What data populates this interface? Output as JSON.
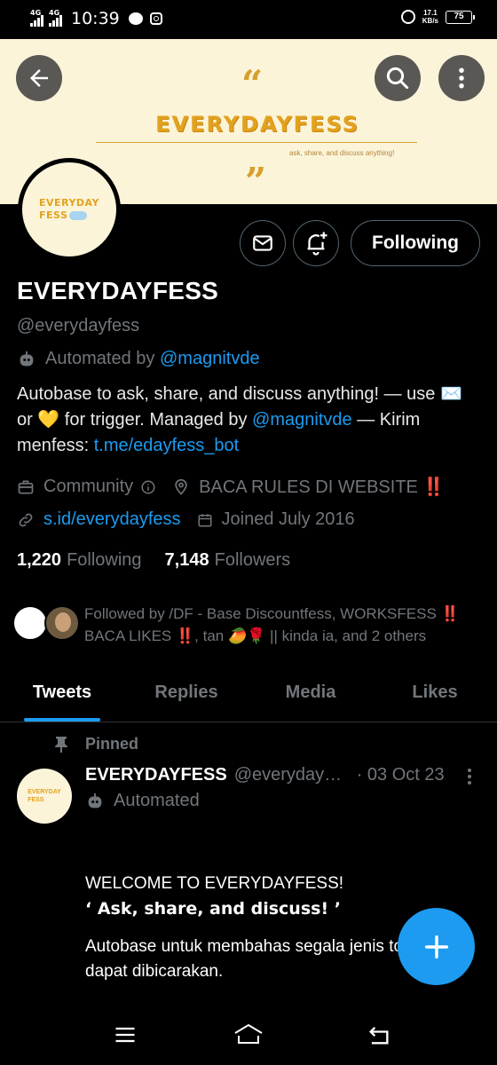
{
  "status_bar": {
    "network1": "4G",
    "network2": "4G",
    "time": "10:39",
    "speed_value": "17.1",
    "speed_unit": "KB/s",
    "battery": "75"
  },
  "banner": {
    "title": "EVERYDAYFESS",
    "tagline": "ask, share, and discuss anything!",
    "open_quote": "“",
    "close_quote": "”"
  },
  "avatar": {
    "line1": "EVERYDAY",
    "line2": "FESS"
  },
  "actions": {
    "follow_label": "Following"
  },
  "profile": {
    "display_name": "EVERYDAYFESS",
    "handle": "@everydayfess",
    "automated_prefix": "Automated by",
    "automated_by": "@magnitvde",
    "bio_part1": "Autobase to ask, share, and discuss anything! — use ✉️ or 💛 for trigger. Managed by",
    "bio_mention": "@magnitvde",
    "bio_part2": "— Kirim menfess:",
    "bio_link": "t.me/edayfess_bot",
    "category": "Community",
    "location": "BACA RULES DI WEBSITE ‼️",
    "website": "s.id/everydayfess",
    "joined": "Joined July 2016",
    "following_count": "1,220",
    "following_label": "Following",
    "followers_count": "7,148",
    "followers_label": "Followers",
    "followed_by_text": "Followed by /DF - Base Discountfess, WORKSFESS ‼️ BACA LIKES ‼️, tan 🥭🌹 || kinda ia, and 2 others"
  },
  "tabs": [
    {
      "label": "Tweets"
    },
    {
      "label": "Replies"
    },
    {
      "label": "Media"
    },
    {
      "label": "Likes"
    }
  ],
  "tweet": {
    "pinned_label": "Pinned",
    "name": "EVERYDAYFESS",
    "handle": "@everydayfess",
    "date": "· 03 Oct 23",
    "automated": "Automated",
    "line1": "WELCOME TO EVERYDAYFESS!",
    "line2": "‘ Ask, share, and discuss! ’",
    "line3": "Autobase untuk membahas segala jenis topik yang dapat dibicarakan."
  },
  "colors": {
    "accent": "#1d9bf0",
    "banner_bg": "#fbf4d9",
    "brand_gold": "#e3a21e",
    "muted": "#71767b"
  },
  "icons": {
    "back": "arrow-left-icon",
    "search": "search-icon",
    "more": "more-vertical-icon",
    "mail": "mail-icon",
    "notify": "bell-plus-icon",
    "robot": "robot-icon",
    "briefcase": "briefcase-icon",
    "info": "info-icon",
    "location": "location-pin-icon",
    "link": "link-icon",
    "calendar": "calendar-icon",
    "pin": "pin-icon",
    "compose": "plus-icon"
  }
}
